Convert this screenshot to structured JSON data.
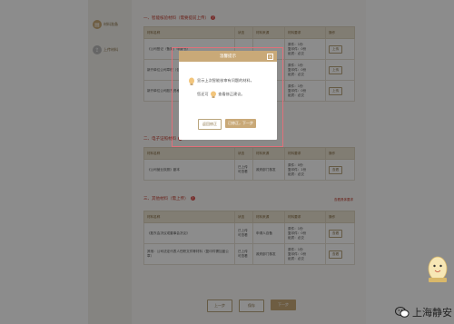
{
  "sidebar": {
    "items": [
      {
        "label": "材料准备"
      },
      {
        "label": "上传材料"
      }
    ]
  },
  "section1": {
    "title": "一、智能核验材料（需要提前上传）",
    "columns": [
      "材料名称",
      "状态",
      "材料来源",
      "材料要求",
      "操作"
    ],
    "rows": [
      {
        "name": "《公司登记（备案）申请书》",
        "status": "",
        "source": "",
        "req": [
          "原件：1份",
          "复印件：0份",
          "纸质：必交"
        ],
        "action": "上传"
      },
      {
        "name": "新开单位公司章程（包括...",
        "status": "",
        "source": "",
        "req": [
          "原件：1份",
          "复印件：0份",
          "纸质：必交"
        ],
        "action": "上传"
      },
      {
        "name": "新开单位公司股东资格...",
        "status": "",
        "source": "",
        "req": [
          "原件：1份",
          "复印件：0份",
          "纸质：必交"
        ],
        "action": "上传"
      }
    ]
  },
  "section2": {
    "title": "二、电子证照材料",
    "columns": [
      "材料名称",
      "状态",
      "材料来源",
      "材料要求",
      "操作"
    ],
    "rows": [
      {
        "name": "《公司营业执照》副本",
        "status": "已上传 可查看",
        "source": "政府部门核发",
        "req": [
          "原件：0份",
          "复印件：1份",
          "纸质：必交"
        ],
        "action": "查看"
      }
    ]
  },
  "section3": {
    "title": "三、其他材料（需上传）",
    "link": "查看具体要求",
    "columns": [
      "材料名称",
      "状态",
      "材料来源",
      "材料要求",
      "操作"
    ],
    "rows": [
      {
        "name": "《股东会决议或董事会决议》",
        "status": "已上传 可查看",
        "source": "申请人自备",
        "req": [
          "原件：1份",
          "复印件：0份",
          "纸质：必交"
        ],
        "action": "查看"
      },
      {
        "name": "其他：公司法定代表人任职文件等材料（复印件需加盖公章）",
        "status": "已上传 可查看",
        "source": "政府部门核发",
        "req": [
          "原件：1份",
          "复印件：0份",
          "纸质：必交"
        ],
        "action": "查看"
      }
    ]
  },
  "bottom": {
    "prev": "上一步",
    "save": "保存",
    "next": "下一步"
  },
  "modal": {
    "title": "温馨提示",
    "close": "×",
    "line1": "显示上次智能核审有问题的材料，",
    "line2_prefix": "您还可",
    "line2_suffix": "查看修正建议。",
    "btn_cancel": "返回修正",
    "btn_confirm": "已修正，下一步"
  },
  "watermark": {
    "text": "上海静安"
  },
  "colors": {
    "accent": "#c9a978",
    "danger": "#c0392b"
  }
}
